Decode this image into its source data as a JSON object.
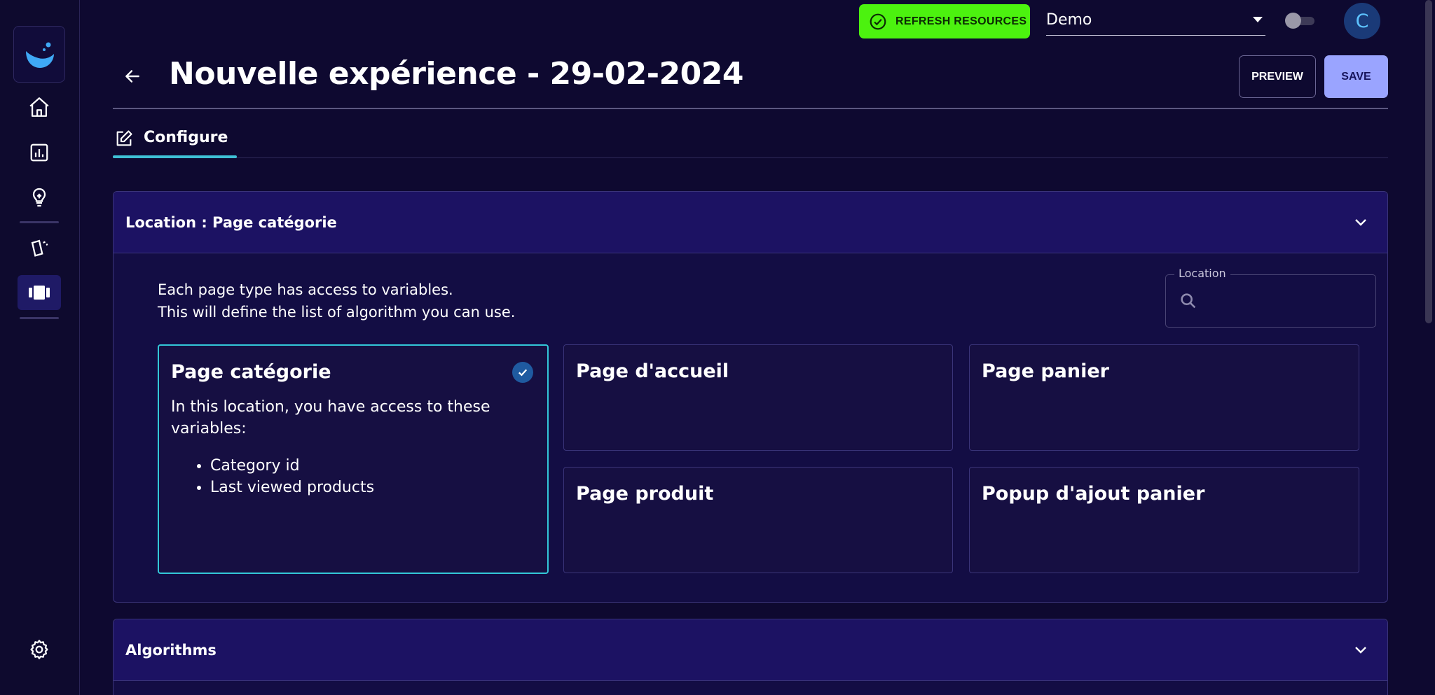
{
  "topbar": {
    "refresh_label": "REFRESH RESOURCES",
    "refresh_color": "#4cf20f",
    "project_select_value": "Demo",
    "avatar_initial": "C"
  },
  "header": {
    "title": "Nouvelle expérience - 29-02-2024",
    "preview_label": "PREVIEW",
    "save_label": "SAVE"
  },
  "tabs": [
    {
      "label": "Configure",
      "icon": "edit-icon",
      "active": true
    }
  ],
  "sidebar": {
    "items": [
      {
        "icon": "home-icon"
      },
      {
        "icon": "chart-icon"
      },
      {
        "icon": "lightbulb-icon"
      },
      {
        "icon": "cards-icon"
      },
      {
        "icon": "carousel-icon",
        "active": true
      },
      {
        "icon": "gear-icon"
      }
    ]
  },
  "location_section": {
    "title": "Location : Page catégorie",
    "description_line1": "Each page type has access to variables.",
    "description_line2": "This will define the list of algorithm you can use.",
    "search_label": "Location",
    "search_value": "",
    "cards": [
      {
        "title": "Page catégorie",
        "selected": true,
        "body": "In this location, you have access to these variables:",
        "variables": [
          "Category id",
          "Last viewed products"
        ]
      },
      {
        "title": "Page d'accueil",
        "selected": false
      },
      {
        "title": "Page panier",
        "selected": false
      },
      {
        "title": "Page produit",
        "selected": false
      },
      {
        "title": "Popup d'ajout panier",
        "selected": false
      }
    ]
  },
  "algorithms_section": {
    "title": "Algorithms"
  },
  "colors": {
    "background": "#0e0930",
    "accent": "#3fc1d6",
    "save": "#9aa4ff"
  }
}
